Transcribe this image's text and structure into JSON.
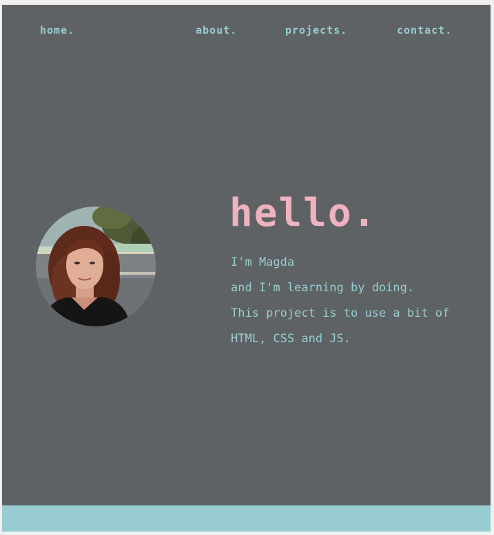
{
  "nav": {
    "items": [
      {
        "label": "home."
      },
      {
        "label": "about."
      },
      {
        "label": "projects."
      },
      {
        "label": "contact."
      }
    ]
  },
  "hero": {
    "title": "hello.",
    "lines": [
      "I'm Magda",
      "and I'm learning by doing.",
      "This project is to use a bit of",
      "HTML, CSS and JS."
    ]
  },
  "colors": {
    "background": "#5f6265",
    "accent_teal": "#97cdd0",
    "accent_pink": "#efb3c0"
  }
}
